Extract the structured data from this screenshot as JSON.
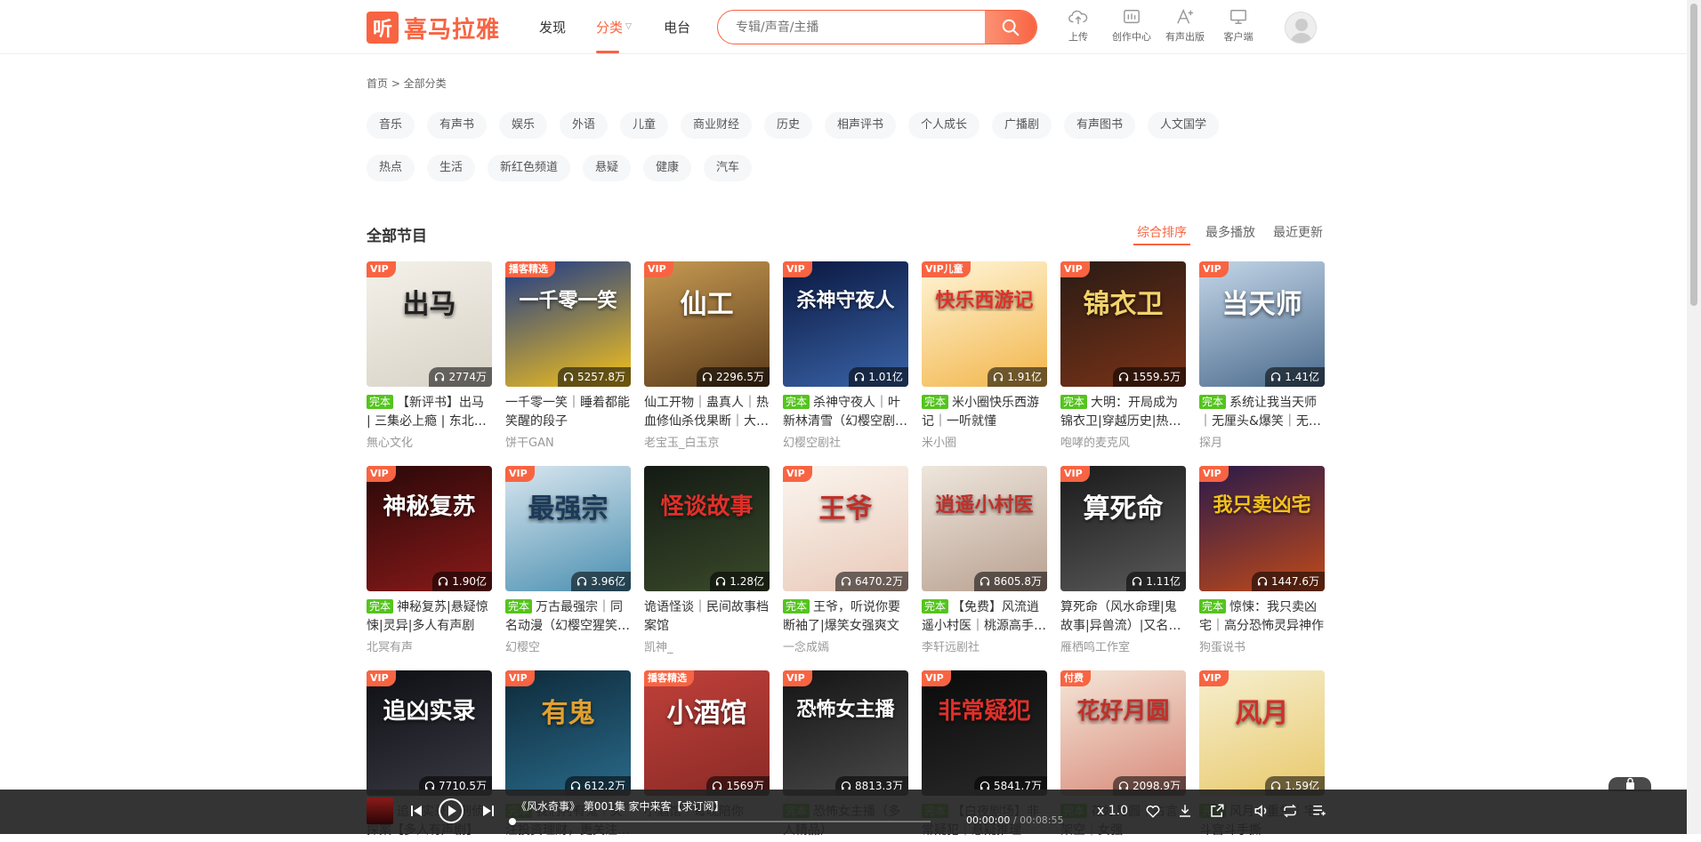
{
  "header": {
    "logo_glyph": "听",
    "logo_text": "喜马拉雅",
    "nav": [
      "发现",
      "分类",
      "电台"
    ],
    "search_placeholder": "专辑/声音/主播",
    "tools": [
      "上传",
      "创作中心",
      "有声出版",
      "客户端"
    ]
  },
  "breadcrumb": "首页 > 全部分类",
  "tags": [
    "音乐",
    "有声书",
    "娱乐",
    "外语",
    "儿童",
    "商业财经",
    "历史",
    "相声评书",
    "个人成长",
    "广播剧",
    "有声图书",
    "人文国学",
    "热点",
    "生活",
    "新红色频道",
    "悬疑",
    "健康",
    "汽车"
  ],
  "section_title": "全部节目",
  "sort_options": [
    "综合排序",
    "最多播放",
    "最近更新"
  ],
  "completed_label": "完本",
  "cards": [
    {
      "badge": "VIP",
      "art": "出马",
      "plays": "2774万",
      "done": true,
      "title": "【新评书】出马 | 三集必上瘾 | 东北出马仙",
      "author": "無心文化",
      "colors": [
        "#f4f1ea",
        "#d8d2c6"
      ],
      "ink": "#222"
    },
    {
      "badge": "播客精选",
      "art": "一千零一笑",
      "plays": "5257.8万",
      "done": false,
      "title": "一千零一笑｜睡着都能笑醒的段子",
      "author": "饼干GAN",
      "colors": [
        "#1c3a8a",
        "#f6c21b"
      ],
      "ink": "#fff"
    },
    {
      "badge": "VIP",
      "art": "仙工",
      "plays": "2296.5万",
      "done": false,
      "title": "仙工开物｜蛊真人｜热血修仙杀伐果断｜大神力作",
      "author": "老宝玉_白玉京",
      "colors": [
        "#c79a52",
        "#5a3a1a"
      ],
      "ink": "#fff"
    },
    {
      "badge": "VIP",
      "art": "杀神守夜人",
      "plays": "1.01亿",
      "done": true,
      "title": "杀神守夜人｜叶新林清雪（幻樱空剧社）",
      "author": "幻樱空剧社",
      "colors": [
        "#0a1740",
        "#3a64a8"
      ],
      "ink": "#fff"
    },
    {
      "badge": "VIP儿童",
      "art": "快乐西游记",
      "plays": "1.91亿",
      "done": true,
      "title": "米小圈快乐西游记｜一听就懂",
      "author": "米小圈",
      "colors": [
        "#fff6d9",
        "#f2b54a"
      ],
      "ink": "#e0302a"
    },
    {
      "badge": "VIP",
      "art": "锦衣卫",
      "plays": "1559.5万",
      "done": true,
      "title": "大明：开局成为锦衣卫|穿越历史|热血权谋",
      "author": "咆哮的麦克风",
      "colors": [
        "#2a1b14",
        "#7a3318"
      ],
      "ink": "#f2d36b"
    },
    {
      "badge": "VIP",
      "art": "当天师",
      "plays": "1.41亿",
      "done": true,
      "title": "系统让我当天师｜无厘头&爆笑｜无敌天师",
      "author": "探月",
      "colors": [
        "#c4d6e8",
        "#4a6a8c"
      ],
      "ink": "#fff"
    },
    {
      "badge": "VIP",
      "art": "神秘复苏",
      "plays": "1.90亿",
      "done": true,
      "title": "神秘复苏|悬疑惊悚|灵异|多人有声剧",
      "author": "北冥有声",
      "colors": [
        "#2a0808",
        "#8a1a1a"
      ],
      "ink": "#fff"
    },
    {
      "badge": "VIP",
      "art": "最强宗",
      "plays": "3.96亿",
      "done": true,
      "title": "万古最强宗｜同名动漫（幻樱空猩笑版）",
      "author": "幻樱空",
      "colors": [
        "#d9e6ef",
        "#4a8fb0"
      ],
      "ink": "#1a3a5a"
    },
    {
      "badge": "",
      "art": "怪谈故事",
      "plays": "1.28亿",
      "done": false,
      "title": "诡语怪谈｜民间故事档案馆",
      "author": "凯神_",
      "colors": [
        "#141a14",
        "#3a4a2a"
      ],
      "ink": "#e0302a"
    },
    {
      "badge": "VIP",
      "art": "王爷",
      "plays": "6470.2万",
      "done": true,
      "title": "王爷，听说你要断袖了|爆笑女强爽文",
      "author": "一念成嫣",
      "colors": [
        "#fbf6ef",
        "#e8c8b8"
      ],
      "ink": "#c0302a"
    },
    {
      "badge": "",
      "art": "逍遥小村医",
      "plays": "8605.8万",
      "done": true,
      "title": "【免费】风流逍遥小村医｜桃源高手下山",
      "author": "李轩远剧社",
      "colors": [
        "#eee6dc",
        "#b8a090"
      ],
      "ink": "#c0302a"
    },
    {
      "badge": "VIP",
      "art": "算死命",
      "plays": "1.11亿",
      "done": false,
      "title": "算死命（风水命理|鬼故事|异兽流）|又名：神算",
      "author": "雁栖鸣工作室",
      "colors": [
        "#1a1a1a",
        "#5a5a5a"
      ],
      "ink": "#fff"
    },
    {
      "badge": "VIP",
      "art": "我只卖凶宅",
      "plays": "1447.6万",
      "done": true,
      "title": "惊悚：我只卖凶宅｜高分恐怖灵异神作",
      "author": "狗蛋说书",
      "colors": [
        "#2a1a4a",
        "#c04a1a"
      ],
      "ink": "#f2c21b"
    },
    {
      "badge": "VIP",
      "art": "追凶实录",
      "plays": "7710.5万",
      "done": true,
      "title": "追凶实录｜刑侦探案【多人有声剧】",
      "author": "",
      "colors": [
        "#0e0e14",
        "#3a3a44"
      ],
      "ink": "#fff"
    },
    {
      "badge": "VIP",
      "art": "有鬼",
      "plays": "612.2万",
      "done": true,
      "title": "我们村有鬼｜关注投资理财，更关注幻樱空社",
      "author": "",
      "colors": [
        "#0e2a3a",
        "#2a6a8a"
      ],
      "ink": "#e0a030"
    },
    {
      "badge": "播客精选",
      "art": "小酒馆",
      "plays": "1569万",
      "done": false,
      "title": "小酒馆｜每晚陪你",
      "author": "",
      "colors": [
        "#c0403a",
        "#8a2a26"
      ],
      "ink": "#fff"
    },
    {
      "badge": "VIP",
      "art": "恐怖女主播",
      "plays": "8813.3万",
      "done": true,
      "title": "恐怖女主播（多人精品）",
      "author": "",
      "colors": [
        "#141414",
        "#4a4a4a"
      ],
      "ink": "#fff"
    },
    {
      "badge": "VIP",
      "art": "非常疑犯",
      "plays": "5841.7万",
      "done": true,
      "title": "【白夜剧场】非常疑犯｜悬疑推理",
      "author": "",
      "colors": [
        "#0a0a0a",
        "#2a2a2a"
      ],
      "ink": "#e0302a"
    },
    {
      "badge": "付费",
      "art": "花好月圆",
      "plays": "2098.9万",
      "done": true,
      "title": "花好月圆｜古言架空｜女强",
      "author": "",
      "colors": [
        "#f4e6d8",
        "#d88a7a"
      ],
      "ink": "#c0302a"
    },
    {
      "badge": "VIP",
      "art": "风月",
      "plays": "1.59亿",
      "done": true,
      "title": "风月｜重生｜宅斗宫斗手撕",
      "author": "",
      "colors": [
        "#f6efd0",
        "#e8c86a"
      ],
      "ink": "#d0302a"
    }
  ],
  "badge_colors": {
    "VIP": "#f86442",
    "VIP儿童": "#f86442",
    "播客精选": "#f86442",
    "付费": "#f86442"
  },
  "player": {
    "title": "《风水奇事》 第001集 家中来客【求订阅】",
    "current_time": "00:00:00",
    "separator": " / ",
    "total_time": "00:08:55",
    "speed": "x 1.0",
    "progress": 0
  }
}
